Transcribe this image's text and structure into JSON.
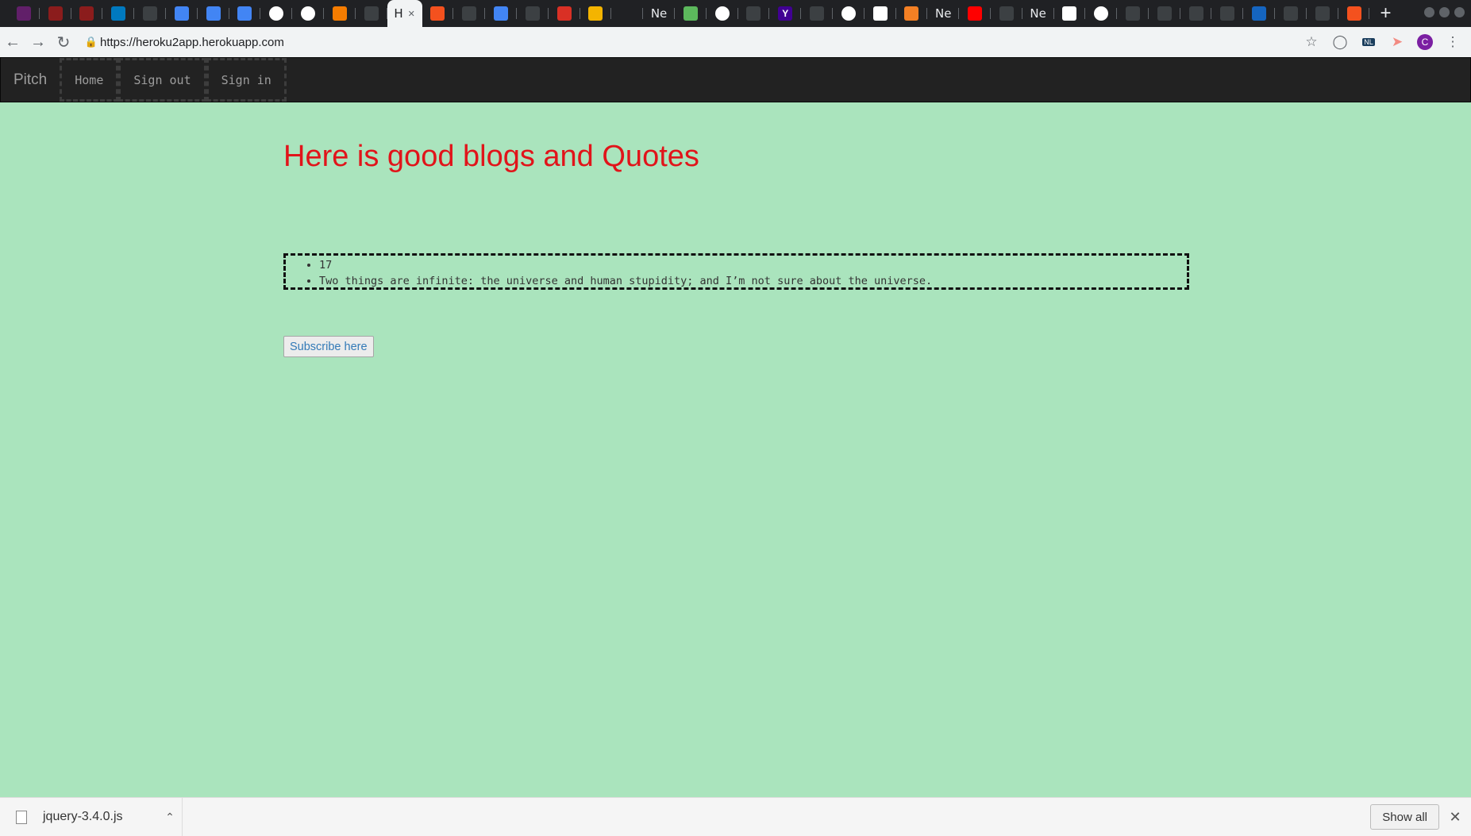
{
  "browser": {
    "tabs": [
      {
        "icon": "slack-icon",
        "color": "#611f69",
        "text": ""
      },
      {
        "icon": "red-app-icon",
        "color": "#8b1c1c",
        "text": ""
      },
      {
        "icon": "red-app-icon",
        "color": "#8b1c1c",
        "text": ""
      },
      {
        "icon": "trello-icon",
        "color": "#0079bf",
        "text": ""
      },
      {
        "icon": "blank-icon",
        "color": "#3c4043",
        "text": ""
      },
      {
        "icon": "docs-icon",
        "color": "#4285f4",
        "text": ""
      },
      {
        "icon": "docs-icon",
        "color": "#4285f4",
        "text": ""
      },
      {
        "icon": "docs-icon",
        "color": "#4285f4",
        "text": ""
      },
      {
        "icon": "google-icon",
        "color": "#ffffff",
        "text": ""
      },
      {
        "icon": "google-icon",
        "color": "#ffffff",
        "text": ""
      },
      {
        "icon": "carrot-icon",
        "color": "#f57c00",
        "text": ""
      },
      {
        "icon": "blank-icon",
        "color": "#3c4043",
        "text": ""
      },
      {
        "icon": "active-tab-icon",
        "color": "#f1f3f4",
        "text": "H",
        "active": true
      },
      {
        "icon": "reload-orange-icon",
        "color": "#f4511e",
        "text": ""
      },
      {
        "icon": "blank-icon",
        "color": "#3c4043",
        "text": ""
      },
      {
        "icon": "docs-icon",
        "color": "#4285f4",
        "text": ""
      },
      {
        "icon": "blank-icon",
        "color": "#3c4043",
        "text": ""
      },
      {
        "icon": "gmail-icon",
        "color": "#d93025",
        "text": ""
      },
      {
        "icon": "slides-icon",
        "color": "#f4b400",
        "text": ""
      },
      {
        "icon": "github-icon",
        "color": "#202124",
        "text": ""
      },
      {
        "icon": "new-tab-icon",
        "color": "#202124",
        "text": "Ne"
      },
      {
        "icon": "green-app-icon",
        "color": "#5cb85c",
        "text": ""
      },
      {
        "icon": "google-icon",
        "color": "#ffffff",
        "text": ""
      },
      {
        "icon": "blank-icon",
        "color": "#3c4043",
        "text": ""
      },
      {
        "icon": "yahoo-icon",
        "color": "#410093",
        "text": "Y"
      },
      {
        "icon": "blank-icon",
        "color": "#3c4043",
        "text": ""
      },
      {
        "icon": "google-icon",
        "color": "#ffffff",
        "text": ""
      },
      {
        "icon": "app-icon",
        "color": "#ffffff",
        "text": ""
      },
      {
        "icon": "stackoverflow-icon",
        "color": "#f48024",
        "text": ""
      },
      {
        "icon": "new-tab-icon",
        "color": "#202124",
        "text": "Ne"
      },
      {
        "icon": "youtube-icon",
        "color": "#ff0000",
        "text": ""
      },
      {
        "icon": "blank-icon",
        "color": "#3c4043",
        "text": ""
      },
      {
        "icon": "new-tab-icon",
        "color": "#202124",
        "text": "Ne"
      },
      {
        "icon": "windows-icon",
        "color": "#ffffff",
        "text": ""
      },
      {
        "icon": "google-icon",
        "color": "#ffffff",
        "text": ""
      },
      {
        "icon": "blank-icon",
        "color": "#3c4043",
        "text": ""
      },
      {
        "icon": "blank-icon",
        "color": "#3c4043",
        "text": ""
      },
      {
        "icon": "blank-icon",
        "color": "#3c4043",
        "text": ""
      },
      {
        "icon": "blank-icon",
        "color": "#3c4043",
        "text": ""
      },
      {
        "icon": "edge-icon",
        "color": "#1565c0",
        "text": ""
      },
      {
        "icon": "blank-icon",
        "color": "#3c4043",
        "text": ""
      },
      {
        "icon": "blank-icon",
        "color": "#3c4043",
        "text": ""
      },
      {
        "icon": "reload-orange-icon",
        "color": "#f4511e",
        "text": ""
      }
    ],
    "new_tab_label": "+",
    "url": "https://heroku2app.herokuapp.com",
    "profile_initial": "C",
    "extension_badge": "NL"
  },
  "navbar": {
    "brand": "Pitch",
    "links": [
      "Home",
      "Sign out",
      "Sign in"
    ]
  },
  "main": {
    "headline": "Here is good blogs and Quotes",
    "quote_items": [
      "17",
      "Two things are infinite: the universe and human stupidity; and I’m not sure about the universe."
    ],
    "subscribe_label": "Subscribe here"
  },
  "download_bar": {
    "filename": "jquery-3.4.0.js",
    "show_all_label": "Show all"
  },
  "colors": {
    "page_background": "#aae4bd",
    "headline": "#e1141a",
    "navbar": "#222222",
    "link": "#337ab7"
  }
}
